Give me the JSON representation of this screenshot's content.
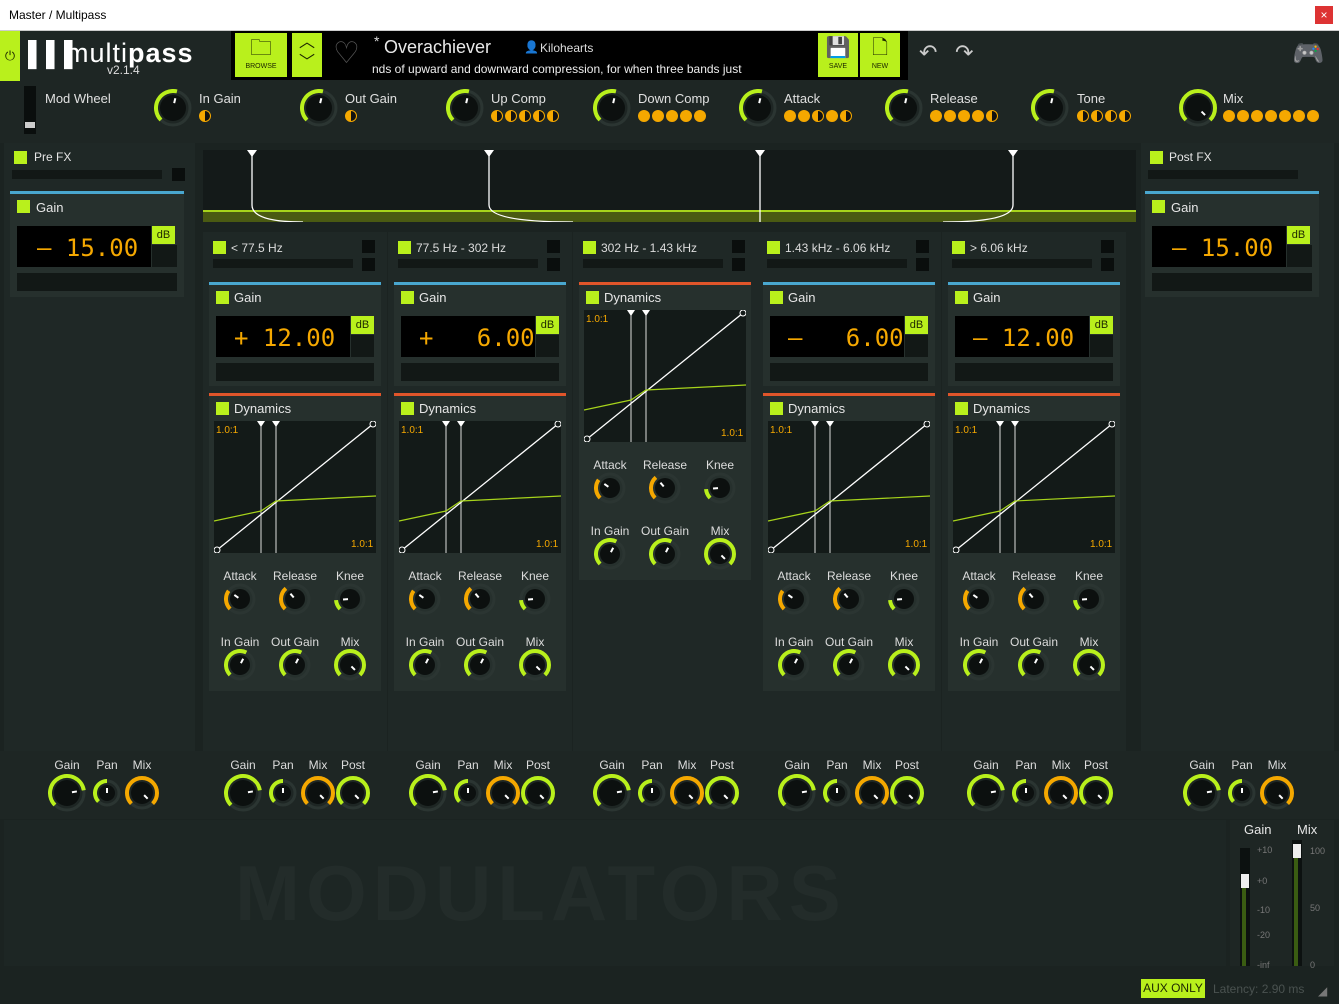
{
  "window": {
    "title": "Master / Multipass",
    "close": "×"
  },
  "header": {
    "logo_a": "multi",
    "logo_b": "pass",
    "version": "v2.1.4",
    "browse": "BROWSE",
    "save": "SAVE",
    "new": "NEW",
    "preset_modified": "*",
    "preset_name": "Overachiever",
    "author": "Kilohearts",
    "description": "nds of upward and downward compression, for when three bands just"
  },
  "macros": [
    {
      "label": "Mod Wheel"
    },
    {
      "label": "In Gain",
      "dots": [
        "h"
      ]
    },
    {
      "label": "Out Gain",
      "dots": [
        "h"
      ]
    },
    {
      "label": "Up Comp",
      "dots": [
        "h",
        "h",
        "h",
        "h",
        "h"
      ]
    },
    {
      "label": "Down Comp",
      "dots": [
        "f",
        "f",
        "f",
        "f",
        "f"
      ]
    },
    {
      "label": "Attack",
      "dots": [
        "f",
        "f",
        "h",
        "f",
        "h"
      ]
    },
    {
      "label": "Release",
      "dots": [
        "f",
        "f",
        "f",
        "f",
        "h"
      ]
    },
    {
      "label": "Tone",
      "dots": [
        "h",
        "h",
        "h",
        "h"
      ]
    },
    {
      "label": "Mix",
      "dots": [
        "f",
        "f",
        "f",
        "f",
        "f",
        "f",
        "f"
      ]
    }
  ],
  "prefx": {
    "label": "Pre FX",
    "gain_label": "Gain",
    "gain_value": "– 15.00",
    "unit": "dB"
  },
  "postfx": {
    "label": "Post FX",
    "gain_label": "Gain",
    "gain_value": "– 15.00",
    "unit": "dB"
  },
  "bands": [
    {
      "range": "< 77.5 Hz",
      "gain_value": "+ 12.00",
      "has_gain": true
    },
    {
      "range": "77.5 Hz - 302 Hz",
      "gain_value": "+   6.00",
      "has_gain": true
    },
    {
      "range": "302 Hz - 1.43 kHz",
      "has_gain": false
    },
    {
      "range": "1.43 kHz - 6.06 kHz",
      "gain_value": "–   6.00",
      "has_gain": true
    },
    {
      "range": "> 6.06 kHz",
      "gain_value": "– 12.00",
      "has_gain": true
    }
  ],
  "labels": {
    "gain": "Gain",
    "dynamics": "Dynamics",
    "db": "dB",
    "ratio": "1.0:1",
    "attack": "Attack",
    "release": "Release",
    "knee": "Knee",
    "in_gain": "In Gain",
    "out_gain": "Out Gain",
    "mix": "Mix",
    "pan": "Pan",
    "post": "Post"
  },
  "footer": {
    "watermark": "MODULATORS",
    "gain": "Gain",
    "mix": "Mix",
    "scale_gain": [
      "+10",
      "+0",
      "-10",
      "-20",
      "-inf"
    ],
    "scale_mix": [
      "100",
      "50",
      "0"
    ],
    "aux": "AUX ONLY",
    "latency": "Latency: 2.90 ms"
  }
}
